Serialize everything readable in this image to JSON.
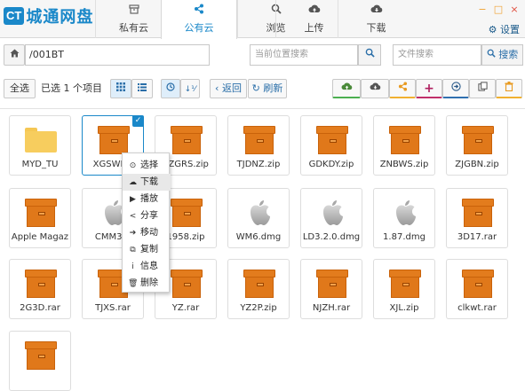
{
  "app": {
    "logo_badge": "CT",
    "logo_text": "城通网盘"
  },
  "tabs": [
    {
      "label": "私有云",
      "icon": "archive-icon"
    },
    {
      "label": "公有云",
      "icon": "share-icon"
    },
    {
      "label": "浏览",
      "icon": "search-icon"
    },
    {
      "label": "上传",
      "icon": "cloud-upload-icon"
    },
    {
      "label": "下载",
      "icon": "cloud-download-icon"
    }
  ],
  "window_controls": {
    "minimize": "−",
    "maximize": "□",
    "close": "×"
  },
  "settings_label": "设置",
  "pathbar": {
    "path": "/001BT",
    "search_placeholder": "当前位置搜索",
    "file_search_placeholder": "文件搜索",
    "search_button": "搜索"
  },
  "toolbar": {
    "select_all": "全选",
    "selected_count": "已选 1 个项目",
    "back": "返回",
    "refresh": "刷新"
  },
  "files": [
    {
      "name": "MYD_TU",
      "type": "folder"
    },
    {
      "name": "XGSWNS",
      "type": "archive",
      "selected": true
    },
    {
      "name": "SZGRS.zip",
      "type": "archive"
    },
    {
      "name": "TJDNZ.zip",
      "type": "archive"
    },
    {
      "name": "GDKDY.zip",
      "type": "archive"
    },
    {
      "name": "ZNBWS.zip",
      "type": "archive"
    },
    {
      "name": "ZJGBN.zip",
      "type": "archive"
    },
    {
      "name": "Apple Magaz",
      "type": "archive"
    },
    {
      "name": "CMM3.6",
      "type": "dmg"
    },
    {
      "name": "1958.zip",
      "type": "archive"
    },
    {
      "name": "WM6.dmg",
      "type": "dmg"
    },
    {
      "name": "LD3.2.0.dmg",
      "type": "dmg"
    },
    {
      "name": "1.87.dmg",
      "type": "dmg"
    },
    {
      "name": "3D17.rar",
      "type": "archive"
    },
    {
      "name": "2G3D.rar",
      "type": "archive"
    },
    {
      "name": "TJXS.rar",
      "type": "archive"
    },
    {
      "name": "YZ.rar",
      "type": "archive"
    },
    {
      "name": "YZ2P.zip",
      "type": "archive"
    },
    {
      "name": "NJZH.rar",
      "type": "archive"
    },
    {
      "name": "XJL.zip",
      "type": "archive"
    },
    {
      "name": "clkwt.rar",
      "type": "archive"
    },
    {
      "name": "",
      "type": "archive"
    }
  ],
  "context_menu": [
    {
      "label": "选择",
      "icon": "check-circle-icon"
    },
    {
      "label": "下载",
      "icon": "cloud-download-icon",
      "hover": true
    },
    {
      "label": "播放",
      "icon": "play-circle-icon"
    },
    {
      "label": "分享",
      "icon": "share-icon"
    },
    {
      "label": "移动",
      "icon": "arrow-circle-icon"
    },
    {
      "label": "复制",
      "icon": "copy-icon"
    },
    {
      "label": "信息",
      "icon": "info-icon"
    },
    {
      "label": "删除",
      "icon": "trash-icon"
    }
  ],
  "colors": {
    "accent": "#1a88c9",
    "archive": "#e0781a",
    "folder": "#f7cd5e"
  }
}
